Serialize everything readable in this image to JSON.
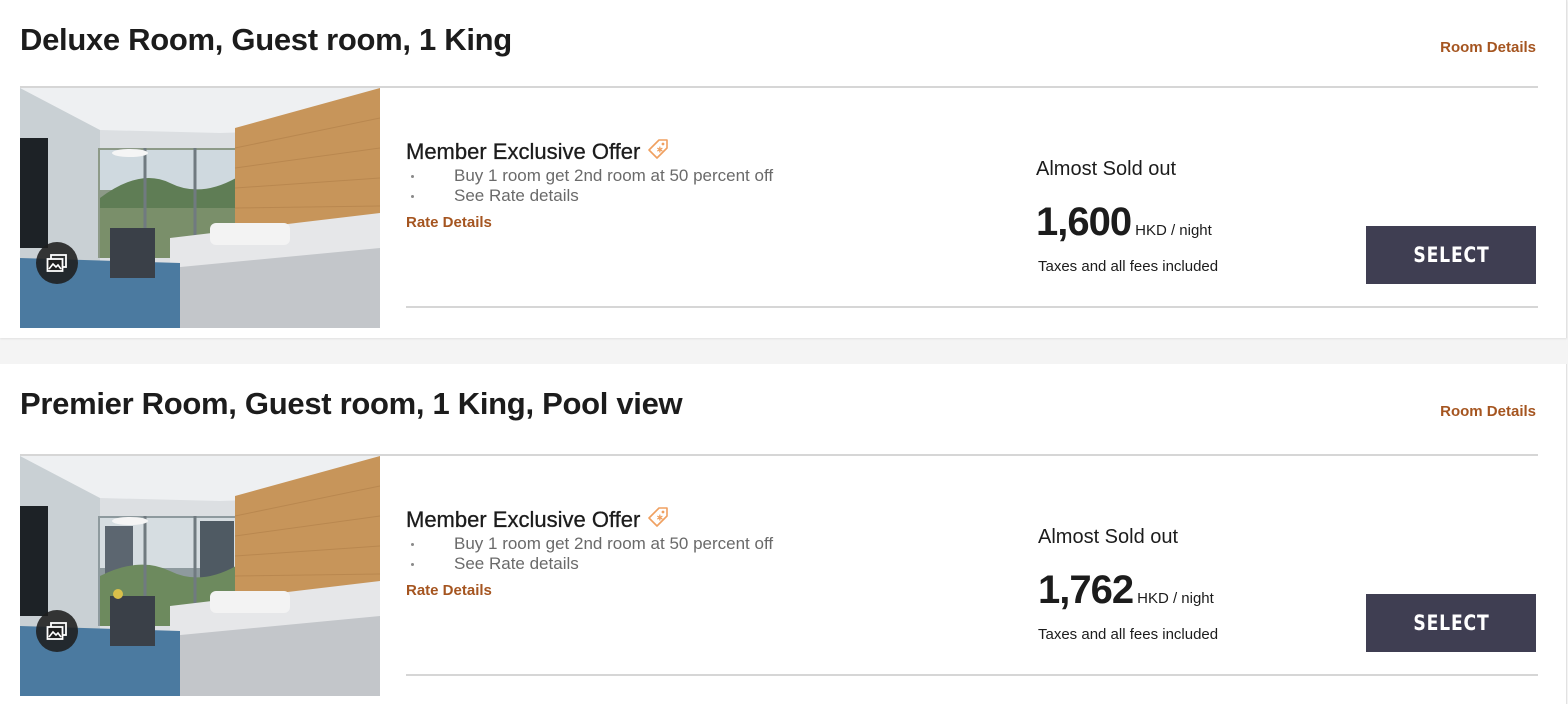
{
  "rooms": [
    {
      "title": "Deluxe Room, Guest room, 1 King",
      "room_details_label": "Room Details",
      "offer": {
        "title": "Member Exclusive Offer",
        "bullets": [
          "Buy 1 room get 2nd room at 50 percent off",
          "See Rate details"
        ],
        "rate_details_label": "Rate Details"
      },
      "availability": "Almost Sold out",
      "price": "1,600",
      "price_unit": "HKD / night",
      "taxes_note": "Taxes and all fees included",
      "select_label": "SELECT"
    },
    {
      "title": "Premier Room, Guest room, 1 King, Pool view",
      "room_details_label": "Room Details",
      "offer": {
        "title": "Member Exclusive Offer",
        "bullets": [
          "Buy 1 room get 2nd room at 50 percent off",
          "See Rate details"
        ],
        "rate_details_label": "Rate Details"
      },
      "availability": "Almost Sold out",
      "price": "1,762",
      "price_unit": "HKD / night",
      "taxes_note": "Taxes and all fees included",
      "select_label": "SELECT"
    }
  ],
  "icons": {
    "offer_tag": "tag-icon",
    "gallery": "photo-gallery-icon"
  },
  "colors": {
    "accent_link": "#a55520",
    "select_button": "#3f3e52",
    "tag_icon": "#f0a060"
  }
}
